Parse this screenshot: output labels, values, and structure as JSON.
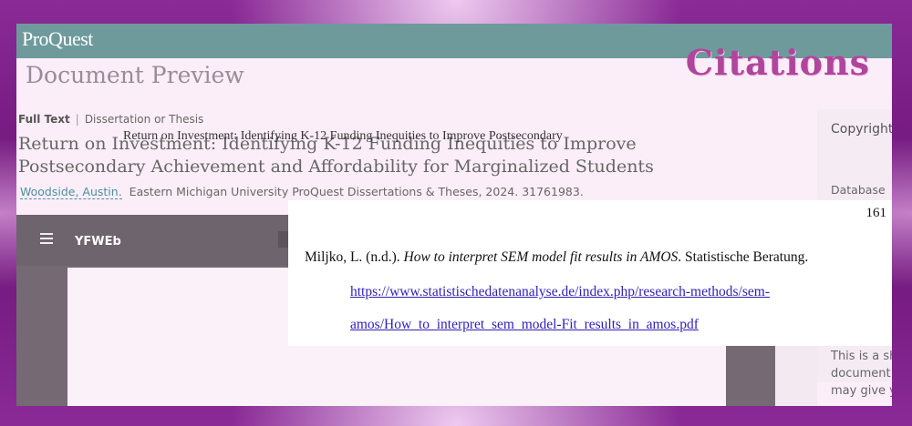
{
  "header": {
    "logo": "ProQuest",
    "page_title": "Document Preview",
    "overlay_heading": "Citations"
  },
  "document": {
    "type_full_text": "Full Text",
    "type_separator": "|",
    "type_label": "Dissertation or Thesis",
    "title_line1": "Return on Investment: Identifying K-12 Funding Inequities to Improve",
    "title_line2": "Postsecondary Achievement and Affordability for Marginalized Students",
    "author": "Woodside, Austin.",
    "source": "Eastern Michigan University ProQuest Dissertations & Theses,  2024. 31761983."
  },
  "sidebar": {
    "copyright": "Copyright",
    "database": "Database c",
    "desc_line1": "This is a sh",
    "desc_line2": "document.",
    "desc_line3": "may give yo"
  },
  "viewer": {
    "title": "YFWEb",
    "page_text": "Return on Investment: Identifying K-12 Funding Inequities to Improve Postsecondary"
  },
  "citation": {
    "page_number": "161",
    "authors": "Miljko, L. (n.d.). ",
    "work_title": "How to interpret SEM model fit results in AMOS",
    "publisher": ". Statistische Beratung.",
    "url_line1": "https://www.statistischedatenanalyse.de/index.php/research-methods/sem-",
    "url_line2": "amos/How_to_interpret_sem_model-Fit_results_in_amos.pdf"
  },
  "colors": {
    "topbar": "#6f9a9c",
    "frame": "#7a1f86",
    "heading_accent": "#b0459c",
    "link": "#2d1fb8"
  },
  "icons": [
    "menu-icon"
  ]
}
